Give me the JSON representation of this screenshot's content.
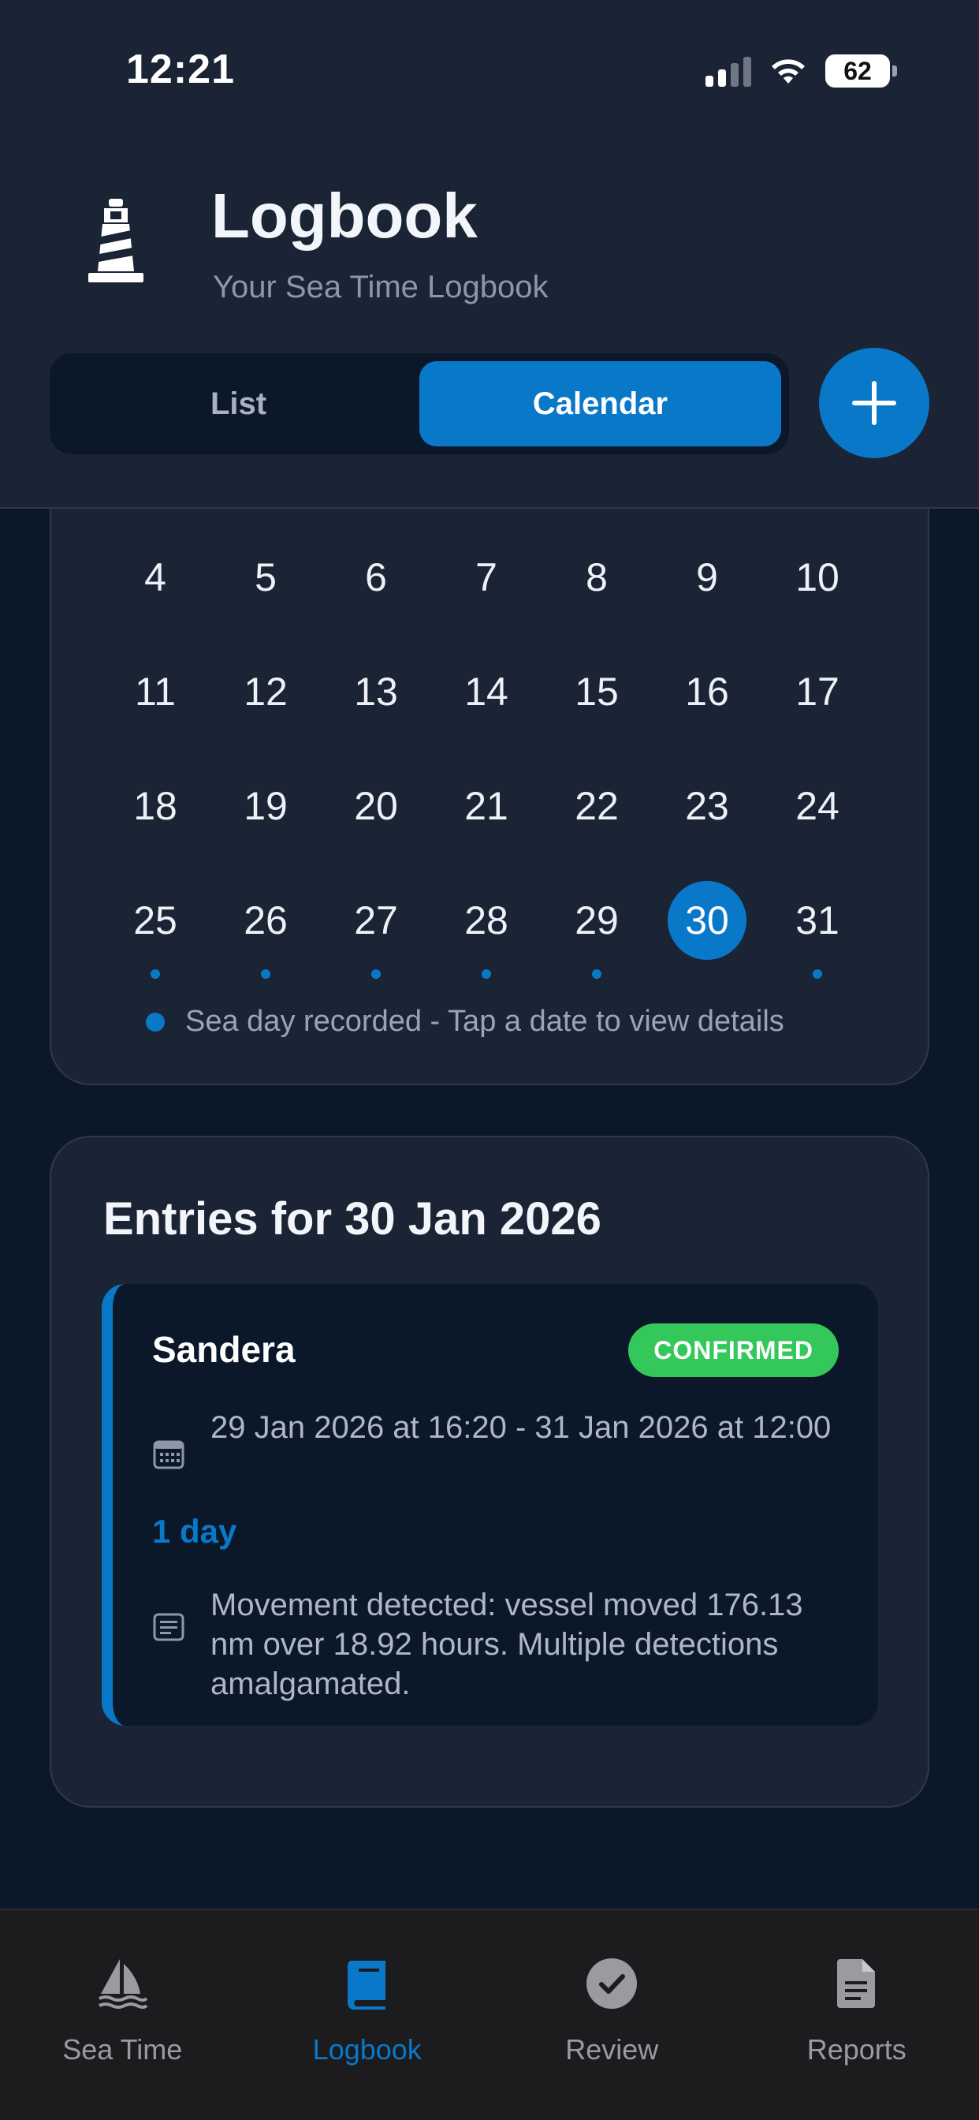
{
  "status_bar": {
    "time": "12:21",
    "battery": "62"
  },
  "header": {
    "title": "Logbook",
    "subtitle": "Your Sea Time Logbook",
    "icon": "lighthouse-icon",
    "view_toggle": {
      "list_label": "List",
      "calendar_label": "Calendar",
      "selected": "Calendar"
    },
    "add_icon": "plus-icon"
  },
  "calendar": {
    "weeks": [
      [
        "4",
        "5",
        "6",
        "7",
        "8",
        "9",
        "10"
      ],
      [
        "11",
        "12",
        "13",
        "14",
        "15",
        "16",
        "17"
      ],
      [
        "18",
        "19",
        "20",
        "21",
        "22",
        "23",
        "24"
      ],
      [
        "25",
        "26",
        "27",
        "28",
        "29",
        "30",
        "31"
      ]
    ],
    "selected_day": "30",
    "sea_days": [
      "25",
      "26",
      "27",
      "28",
      "29",
      "30",
      "31"
    ],
    "legend": "Sea day recorded - Tap a date to view details"
  },
  "entries": {
    "title": "Entries for 30 Jan 2026",
    "items": [
      {
        "vessel": "Sandera",
        "status": "CONFIRMED",
        "date_range": "29 Jan 2026 at 16:20 - 31 Jan 2026 at 12:00",
        "duration": "1 day",
        "notes": "Movement detected: vessel moved 176.13 nm over 18.92 hours. Multiple detections amalgamated."
      }
    ]
  },
  "tabbar": {
    "tabs": [
      {
        "label": "Sea Time",
        "icon": "sailboat-icon"
      },
      {
        "label": "Logbook",
        "icon": "book-icon"
      },
      {
        "label": "Review",
        "icon": "checkmark-circle-icon"
      },
      {
        "label": "Reports",
        "icon": "document-icon"
      }
    ],
    "active": "Logbook"
  },
  "colors": {
    "accent": "#0a78c8",
    "confirmed": "#34c759",
    "background": "#0b1829",
    "card": "#1b2434"
  }
}
